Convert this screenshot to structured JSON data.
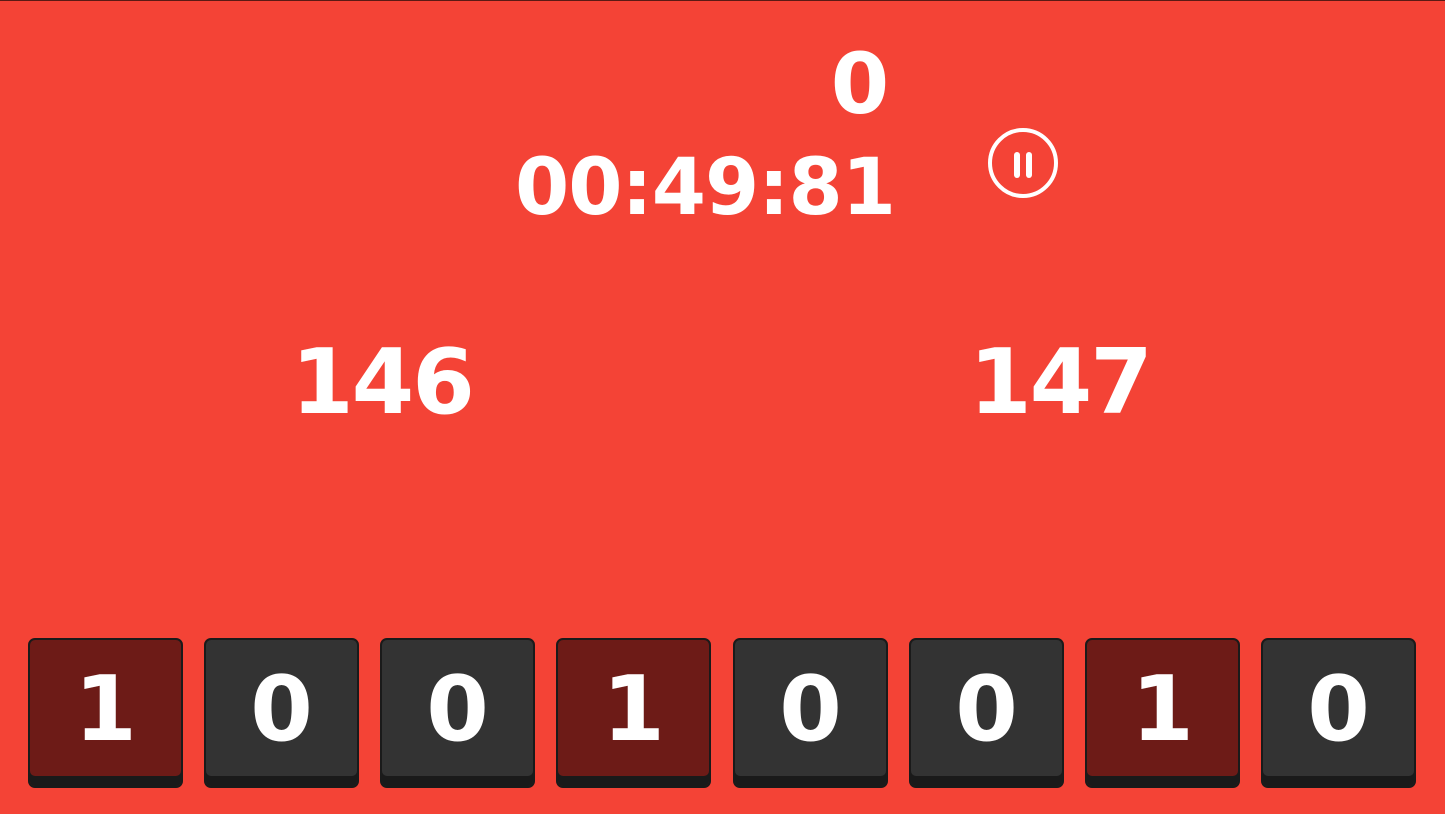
{
  "hud": {
    "score": "0",
    "timer": "00:49:81"
  },
  "targets": {
    "left": "146",
    "right": "147"
  },
  "tiles": [
    {
      "label": "1",
      "state": "on"
    },
    {
      "label": "0",
      "state": "off"
    },
    {
      "label": "0",
      "state": "off"
    },
    {
      "label": "1",
      "state": "on"
    },
    {
      "label": "0",
      "state": "off"
    },
    {
      "label": "0",
      "state": "off"
    },
    {
      "label": "1",
      "state": "on"
    },
    {
      "label": "0",
      "state": "off"
    }
  ],
  "colors": {
    "background": "#f44336",
    "tile_on": "#6d1b17",
    "tile_off": "#333333",
    "text": "#ffffff"
  },
  "icons": {
    "pause": "pause-icon"
  }
}
